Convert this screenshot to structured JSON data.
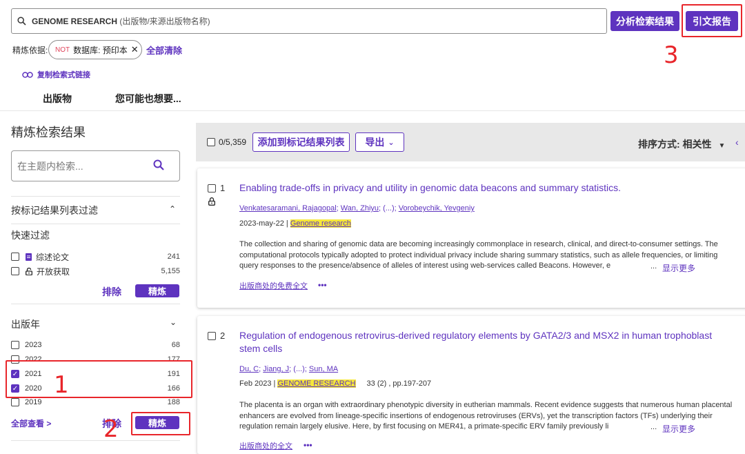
{
  "search": {
    "query": "GENOME RESEARCH",
    "hint": " (出版物/来源出版物名称)",
    "analyze_label": "分析检索结果",
    "citation_report_label": "引文报告"
  },
  "refine_bar": {
    "label": "精炼依据:",
    "chip_not": "NOT",
    "chip_text": "数据库: 预印本",
    "chip_close": "✕",
    "clear_all": "全部清除",
    "copy_link": "复制检索式链接"
  },
  "tabs": [
    "出版物",
    "您可能也想要..."
  ],
  "sidebar": {
    "title": "精炼检索结果",
    "search_placeholder": "在主题内检索...",
    "marked_list_filter": "按标记结果列表过滤",
    "quick_filter_title": "快速过滤",
    "quick_filters": [
      {
        "label": "综述论文",
        "count": "241",
        "checked": false,
        "icon": "document-icon"
      },
      {
        "label": "开放获取",
        "count": "5,155",
        "checked": false,
        "icon": "unlock-icon"
      }
    ],
    "exclude_label": "排除",
    "refine_label": "精炼",
    "pub_year_title": "出版年",
    "years": [
      {
        "label": "2023",
        "count": "68",
        "checked": false
      },
      {
        "label": "2022",
        "count": "177",
        "checked": false
      },
      {
        "label": "2021",
        "count": "191",
        "checked": true
      },
      {
        "label": "2020",
        "count": "166",
        "checked": true
      },
      {
        "label": "2019",
        "count": "188",
        "checked": false
      }
    ],
    "view_all": "全部查看 >"
  },
  "annotations": {
    "one": "1",
    "two": "2",
    "three": "3"
  },
  "results_header": {
    "selected_count": "0/5,359",
    "add_to_marked": "添加到标记结果列表",
    "export": "导出",
    "sort": "排序方式: 相关性"
  },
  "records": [
    {
      "num": "1",
      "title": "Enabling trade-offs in privacy and utility in genomic data beacons and summary statistics.",
      "authors": [
        {
          "name": "Venkatesaramani, Rajagopal",
          "link": true
        },
        {
          "name": "; ",
          "link": false
        },
        {
          "name": "Wan, Zhiyu",
          "link": true
        },
        {
          "name": "; (...); ",
          "link": false
        },
        {
          "name": "Vorobeychik, Yevgeniy",
          "link": true
        }
      ],
      "date": "2023-may-22 | ",
      "journal": "Genome research",
      "extra": "",
      "abstract": "The collection and sharing of genomic data are becoming increasingly commonplace in research, clinical, and direct-to-consumer settings. The computational protocols typically adopted to protect individual privacy include sharing summary statistics, such as allele frequencies, or limiting query responses to the presence/absence of alleles of interest using web-services called Beacons. However, e",
      "ellipsis": "...",
      "show_more": "显示更多",
      "fulltext": "出版商处的免费全文",
      "more": "•••"
    },
    {
      "num": "2",
      "title": "Regulation of endogenous retrovirus-derived regulatory elements by GATA2/3 and MSX2 in human trophoblast stem cells",
      "authors": [
        {
          "name": "Du, C",
          "link": true
        },
        {
          "name": "; ",
          "link": false
        },
        {
          "name": "Jiang, J",
          "link": true
        },
        {
          "name": "; (...); ",
          "link": false
        },
        {
          "name": "Sun, MA",
          "link": true
        }
      ],
      "date": "Feb 2023 | ",
      "journal": "GENOME RESEARCH",
      "extra": "33 (2) , pp.197-207",
      "abstract": "The placenta is an organ with extraordinary phenotypic diversity in eutherian mammals. Recent evidence suggests that numerous human placental enhancers are evolved from lineage-specific insertions of endogenous retroviruses (ERVs), yet the transcription factors (TFs) underlying their regulation remain largely elusive. Here, by first focusing on MER41, a primate-specific ERV family previously li",
      "ellipsis": "...",
      "show_more": "显示更多",
      "fulltext": "出版商处的全文",
      "more": "•••"
    }
  ],
  "colors": {
    "accent": "#5e33bf",
    "annotation": "#e8252a",
    "highlight": "#f6e83a"
  }
}
